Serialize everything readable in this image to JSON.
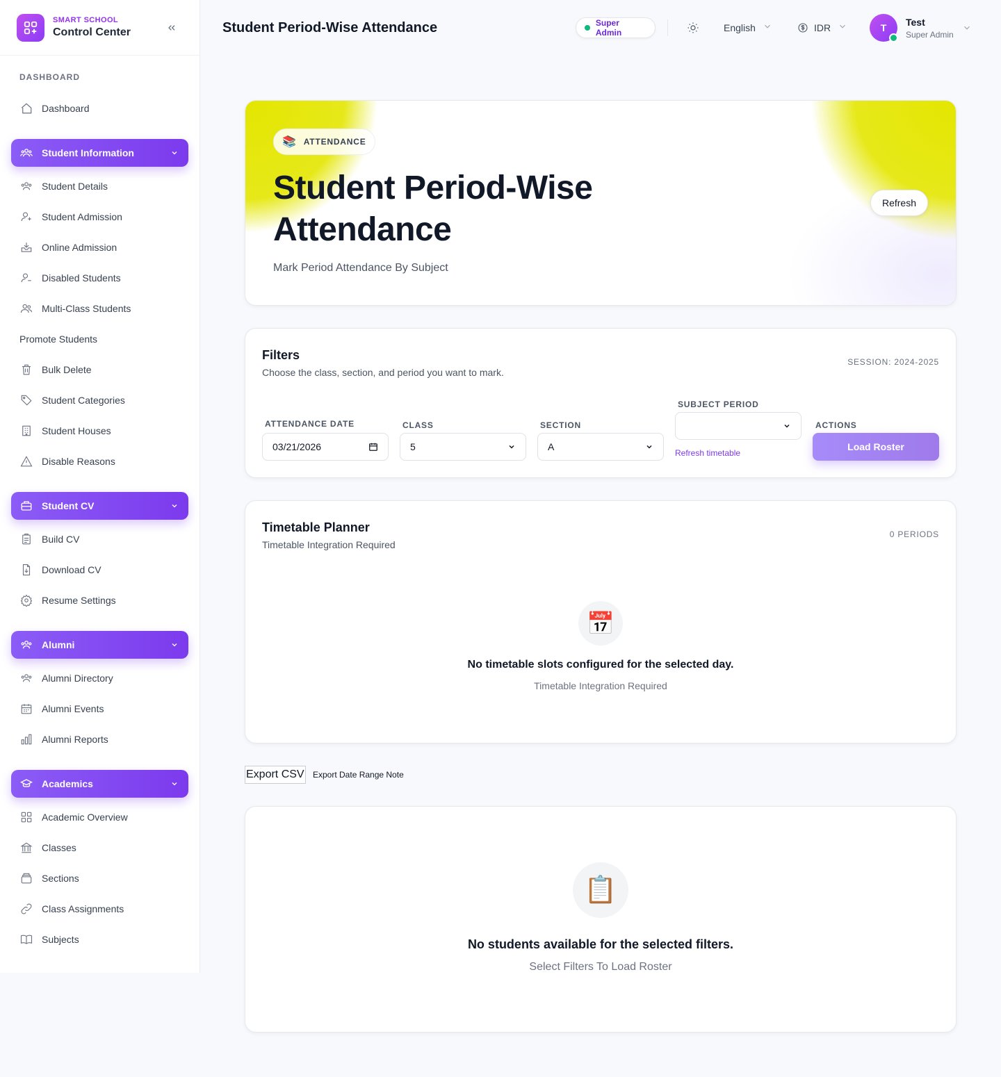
{
  "brand": {
    "subtitle": "SMART SCHOOL",
    "title": "Control Center"
  },
  "sidebar": {
    "section_label": "DASHBOARD",
    "dashboard": "Dashboard",
    "groups": [
      {
        "label": "Student Information",
        "items": [
          "Student Details",
          "Student Admission",
          "Online Admission",
          "Disabled Students",
          "Multi-Class Students",
          "Promote Students",
          "Bulk Delete",
          "Student Categories",
          "Student Houses",
          "Disable Reasons"
        ]
      },
      {
        "label": "Student CV",
        "items": [
          "Build CV",
          "Download CV",
          "Resume Settings"
        ]
      },
      {
        "label": "Alumni",
        "items": [
          "Alumni Directory",
          "Alumni Events",
          "Alumni Reports"
        ]
      },
      {
        "label": "Academics",
        "items": [
          "Academic Overview",
          "Classes",
          "Sections",
          "Class Assignments",
          "Subjects"
        ]
      }
    ]
  },
  "header": {
    "title": "Student Period-Wise Attendance",
    "role": "Super Admin",
    "language": "English",
    "currency": "IDR",
    "user": {
      "initial": "T",
      "name": "Test",
      "role": "Super Admin"
    }
  },
  "hero": {
    "badge_emoji": "📚",
    "badge": "ATTENDANCE",
    "title": "Student Period-Wise Attendance",
    "subtitle": "Mark Period Attendance By Subject",
    "refresh": "Refresh"
  },
  "filters": {
    "title": "Filters",
    "subtitle": "Choose the class, section, and period you want to mark.",
    "session": "SESSION: 2024-2025",
    "date_label": "ATTENDANCE DATE",
    "date_value": "03/21/2026",
    "class_label": "CLASS",
    "class_value": "5",
    "section_label": "SECTION",
    "section_value": "A",
    "period_label": "SUBJECT PERIOD",
    "period_value": "",
    "refresh_timetable": "Refresh timetable",
    "actions_label": "ACTIONS",
    "load_roster": "Load Roster"
  },
  "timetable": {
    "title": "Timetable Planner",
    "subtitle": "Timetable Integration Required",
    "count": "0 PERIODS",
    "empty_icon": "📅",
    "empty_title": "No timetable slots configured for the selected day.",
    "empty_sub": "Timetable Integration Required"
  },
  "export": {
    "button": "Export CSV",
    "note": "Export Date Range Note"
  },
  "roster": {
    "empty_icon": "📋",
    "empty_title": "No students available for the selected filters.",
    "empty_sub": "Select Filters To Load Roster"
  },
  "colors": {
    "accent": "#7c3aed",
    "hero_glow": "#e4e600",
    "online": "#10b981"
  }
}
